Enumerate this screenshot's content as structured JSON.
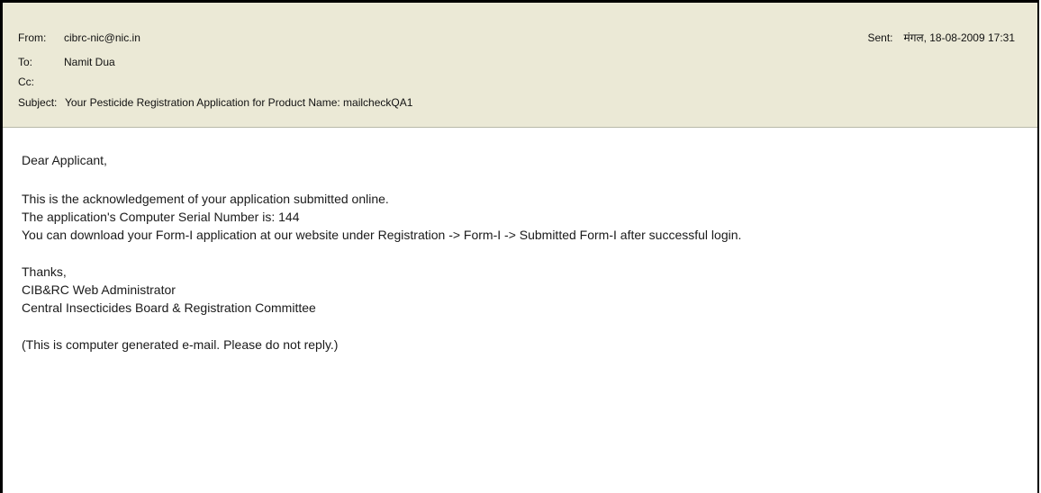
{
  "header": {
    "from_label": "From:",
    "from_value": "cibrc-nic@nic.in",
    "to_label": "To:",
    "to_value": "Namit Dua",
    "cc_label": "Cc:",
    "cc_value": "",
    "subject_label": "Subject:",
    "subject_value": "Your Pesticide Registration Application for Product Name: mailcheckQA1",
    "sent_label": "Sent:",
    "sent_value": "मंगल, 18-08-2009 17:31"
  },
  "message": {
    "greeting": "Dear Applicant,",
    "line1": "This is the acknowledgement of your application submitted online.",
    "line2": "The application's Computer Serial Number is: 144",
    "line3": "You can download your Form-I application at our website under Registration -> Form-I -> Submitted Form-I after successful login.",
    "thanks": "Thanks,",
    "sig1": "CIB&RC Web Administrator",
    "sig2": "Central Insecticides Board & Registration Committee",
    "footer": "(This is computer generated e-mail. Please do not reply.)"
  }
}
